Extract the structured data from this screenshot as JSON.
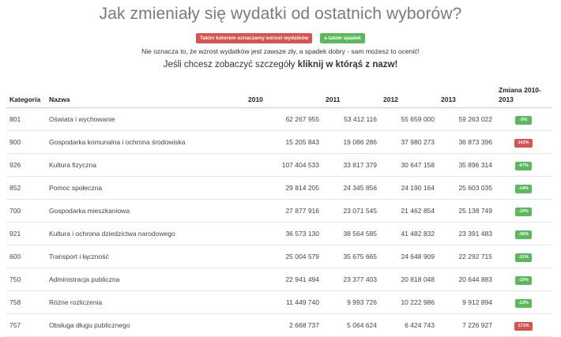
{
  "header": {
    "title": "Jak zmieniały się wydatki od ostatnich wyborów?",
    "legend_up": "Takim kolorem oznaczamy wzrost wydatków",
    "legend_down": "a takim spadek",
    "note": "Nie oznacza to, że wzrost wydatków jest zawsze zły, a spadek dobry - sam możesz to ocenić!",
    "cta_prefix": "Jeśli chcesz zobaczyć szczegóły ",
    "cta_bold": "kliknij w którąś z nazw!"
  },
  "colors": {
    "up": "#d9534f",
    "down": "#5cb85c"
  },
  "table": {
    "columns": {
      "category": "Kategoria",
      "name": "Nazwa",
      "y2010": "2010",
      "y2011": "2011",
      "y2012": "2012",
      "y2013": "2013",
      "change": "Zmiana 2010-2013"
    },
    "rows": [
      {
        "category": "801",
        "name": "Oświata i wychowanie",
        "y2010": "62 267 955",
        "y2011": "53 412 116",
        "y2012": "55 659 000",
        "y2013": "59 263 022",
        "change": "-5%",
        "trend": "down"
      },
      {
        "category": "900",
        "name": "Gospodarka komunalna i ochrona środowiska",
        "y2010": "15 205 843",
        "y2011": "19 086 286",
        "y2012": "37 980 273",
        "y2013": "36 873 396",
        "change": "142%",
        "trend": "up"
      },
      {
        "category": "926",
        "name": "Kultura fizyczna",
        "y2010": "107 404 533",
        "y2011": "33 817 379",
        "y2012": "30 647 158",
        "y2013": "35 896 314",
        "change": "-67%",
        "trend": "down"
      },
      {
        "category": "852",
        "name": "Pomoc społeczna",
        "y2010": "29 814 205",
        "y2011": "24 345 856",
        "y2012": "24 190 164",
        "y2013": "25 603 035",
        "change": "-14%",
        "trend": "down"
      },
      {
        "category": "700",
        "name": "Gospodarka mieszkaniowa",
        "y2010": "27 877 916",
        "y2011": "23 071 545",
        "y2012": "21 462 854",
        "y2013": "25 138 749",
        "change": "-10%",
        "trend": "down"
      },
      {
        "category": "921",
        "name": "Kultura i ochrona dziedzictwa narodowego",
        "y2010": "36 573 130",
        "y2011": "38 564 585",
        "y2012": "41 482 832",
        "y2013": "23 391 483",
        "change": "-36%",
        "trend": "down"
      },
      {
        "category": "600",
        "name": "Transport i łączność",
        "y2010": "25 004 579",
        "y2011": "35 675 665",
        "y2012": "24 648 909",
        "y2013": "22 292 715",
        "change": "-11%",
        "trend": "down"
      },
      {
        "category": "750",
        "name": "Administracja publiczna",
        "y2010": "22 941 494",
        "y2011": "23 377 403",
        "y2012": "20 818 048",
        "y2013": "20 644 883",
        "change": "-10%",
        "trend": "down"
      },
      {
        "category": "758",
        "name": "Różne rozliczenia",
        "y2010": "11 449 740",
        "y2011": "9 993 726",
        "y2012": "10 222 986",
        "y2013": "9 912 894",
        "change": "-13%",
        "trend": "down"
      },
      {
        "category": "757",
        "name": "Obsługa długu publicznego",
        "y2010": "2 668 737",
        "y2011": "5 064 624",
        "y2012": "6 424 743",
        "y2013": "7 226 927",
        "change": "171%",
        "trend": "up"
      }
    ]
  }
}
